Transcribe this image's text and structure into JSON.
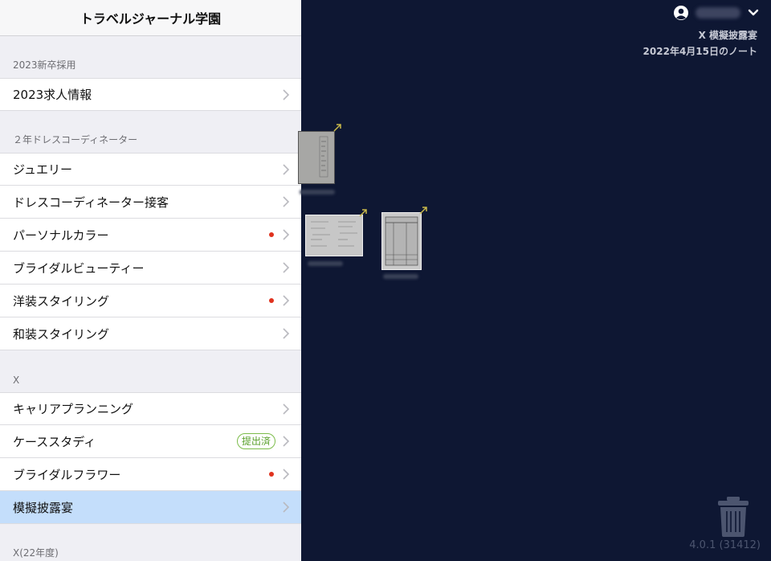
{
  "sidebar": {
    "title": "トラベルジャーナル学園",
    "sections": [
      {
        "header": "2023新卒採用",
        "items": [
          {
            "label": "2023求人情報"
          }
        ]
      },
      {
        "header": "２年ドレスコーディネーター",
        "items": [
          {
            "label": "ジュエリー"
          },
          {
            "label": "ドレスコーディネーター接客"
          },
          {
            "label": "パーソナルカラー",
            "dot": true
          },
          {
            "label": "ブライダルビューティー"
          },
          {
            "label": "洋装スタイリング",
            "dot": true
          },
          {
            "label": "和装スタイリング"
          }
        ]
      },
      {
        "header": "X",
        "items": [
          {
            "label": "キャリアプランニング"
          },
          {
            "label": "ケーススタディ",
            "badge": "提出済"
          },
          {
            "label": "ブライダルフラワー",
            "dot": true
          },
          {
            "label": "模擬披露宴",
            "selected": true
          }
        ]
      },
      {
        "header": "X(22年度)",
        "items": []
      }
    ]
  },
  "main": {
    "note_title": "X 模擬披露宴",
    "note_date": "2022年4月15日のノート",
    "version": "4.0.1 (31412)",
    "icons": {
      "user": "user-circle-icon",
      "menu": "chevron-down-icon",
      "trash": "trash-icon"
    }
  },
  "colors": {
    "background": "#0e1733",
    "selected_row": "#c4defb",
    "dot": "#e0321e",
    "badge": "#5aa02c",
    "arrow": "#c8b84a"
  }
}
